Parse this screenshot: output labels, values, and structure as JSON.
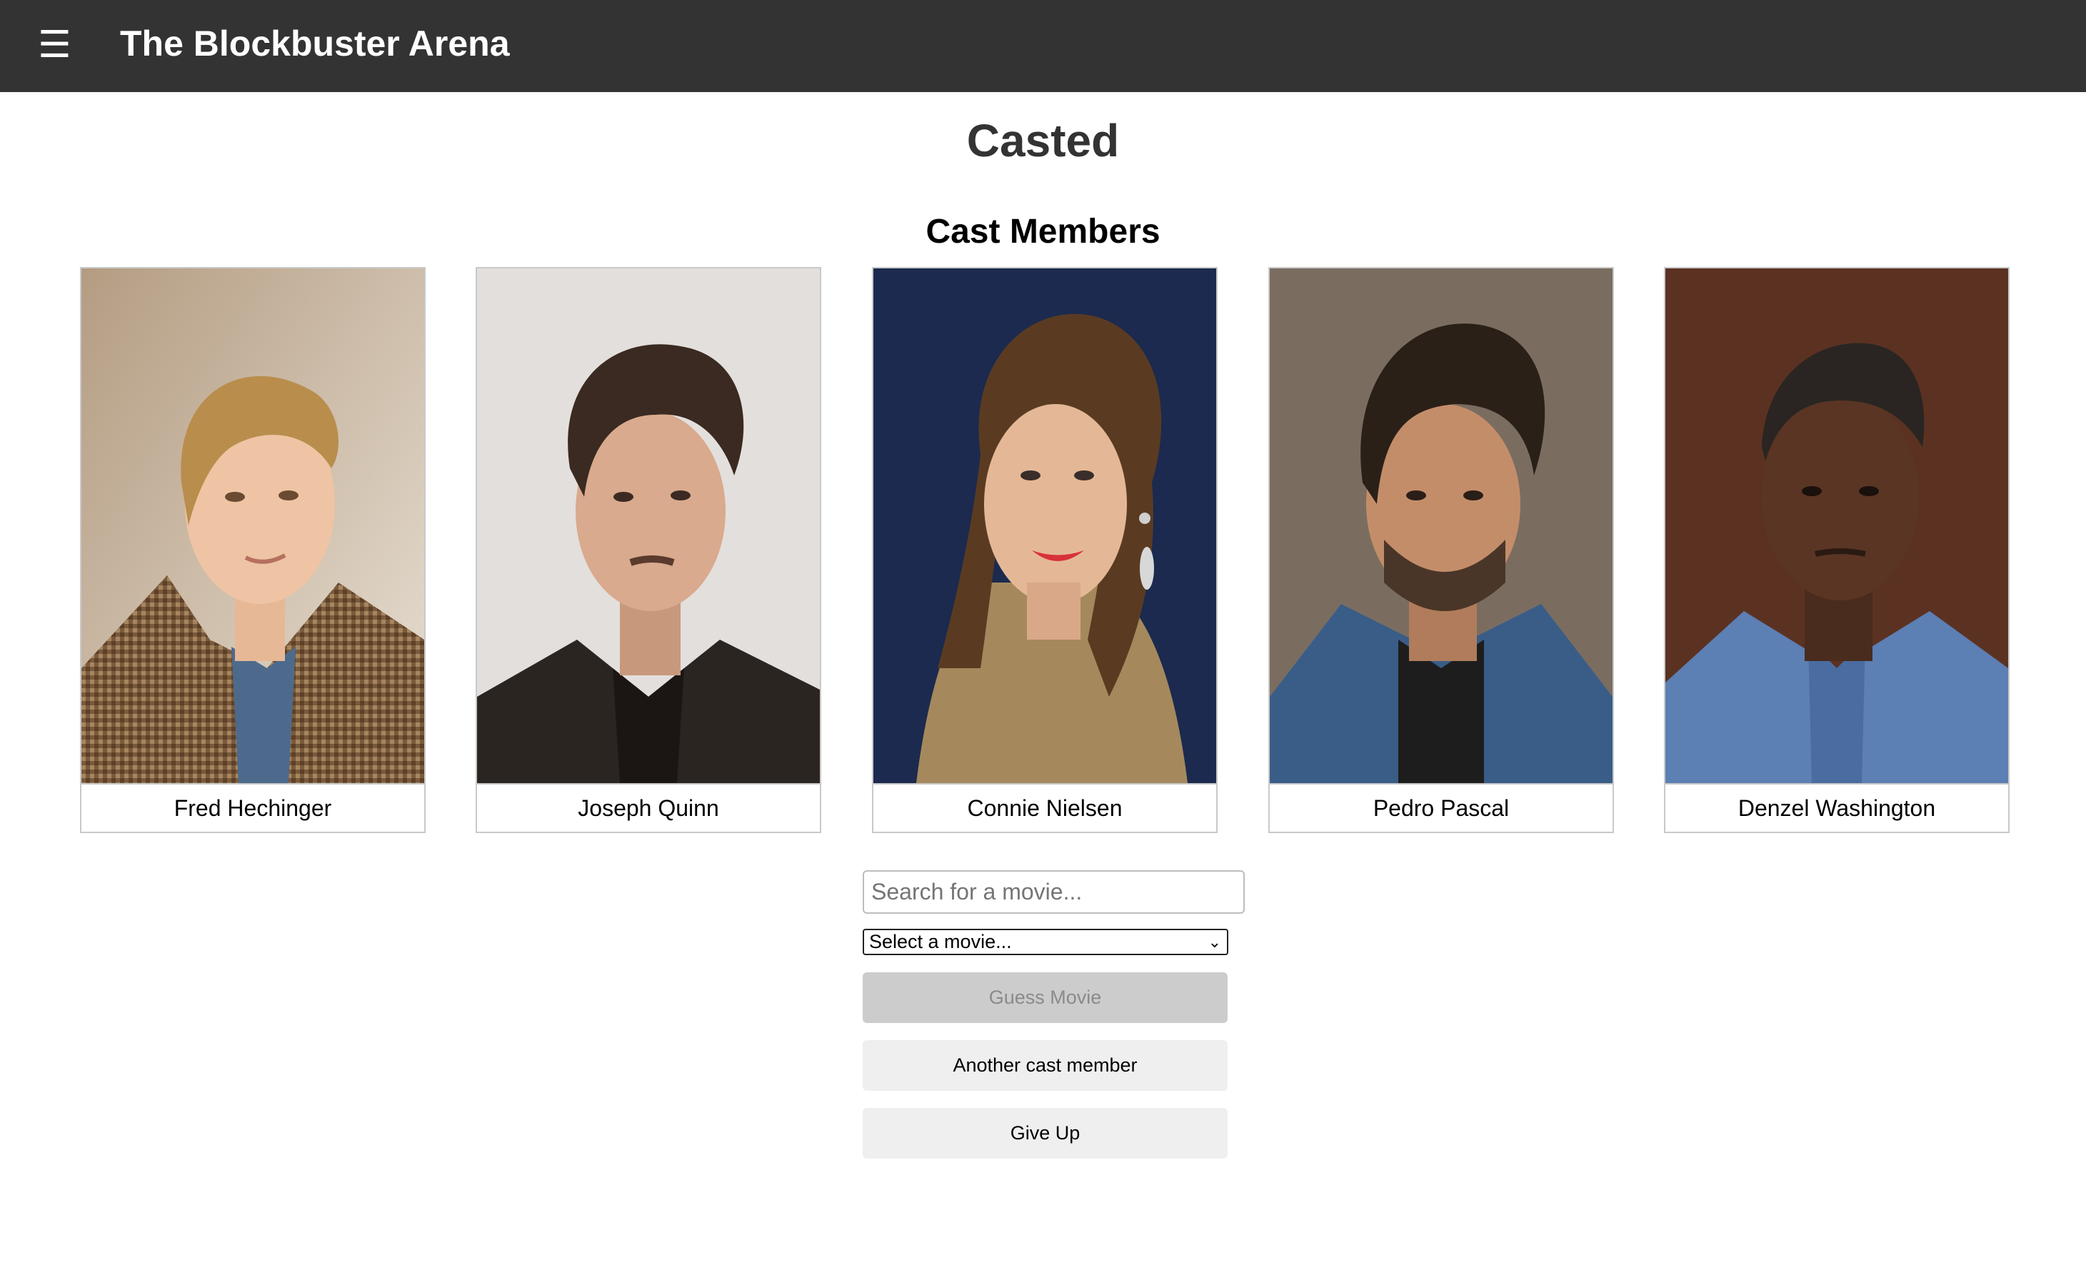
{
  "header": {
    "menu_icon": "hamburger-menu-icon",
    "menu_glyph": "☰",
    "brand": "The Blockbuster Arena"
  },
  "page": {
    "title": "Casted",
    "section_title": "Cast Members"
  },
  "cast": [
    {
      "name": "Fred Hechinger"
    },
    {
      "name": "Joseph Quinn"
    },
    {
      "name": "Connie Nielsen"
    },
    {
      "name": "Pedro Pascal"
    },
    {
      "name": "Denzel Washington"
    }
  ],
  "controls": {
    "search_placeholder": "Search for a movie...",
    "search_value": "",
    "select_value": "Select a movie...",
    "guess_label": "Guess Movie",
    "guess_disabled": true,
    "another_label": "Another cast member",
    "giveup_label": "Give Up"
  },
  "colors": {
    "header_bg": "#333333",
    "disabled_button": "#cccccc",
    "button_bg": "#efefef"
  }
}
